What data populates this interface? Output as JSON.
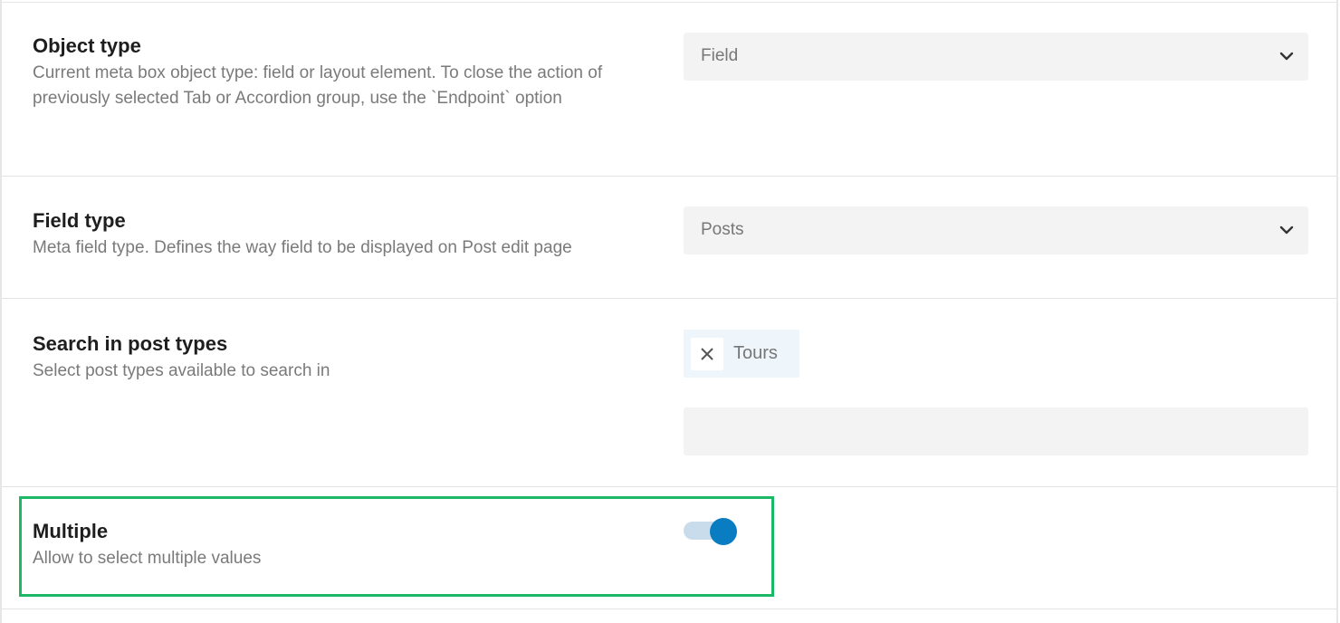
{
  "fields": {
    "object_type": {
      "title": "Object type",
      "description": "Current meta box object type: field or layout element. To close the action of previously selected Tab or Accordion group, use the `Endpoint` option",
      "value": "Field"
    },
    "field_type": {
      "title": "Field type",
      "description": "Meta field type. Defines the way field to be displayed on Post edit page",
      "value": "Posts"
    },
    "search_post_types": {
      "title": "Search in post types",
      "description": "Select post types available to search in",
      "selected_tags": [
        {
          "label": "Tours"
        }
      ],
      "search_value": ""
    },
    "multiple": {
      "title": "Multiple",
      "description": "Allow to select multiple values",
      "enabled": true
    }
  },
  "icons": {
    "select_chevron": "chevron-down-icon",
    "tag_remove": "close-icon"
  },
  "colors": {
    "highlight_border": "#1db866",
    "toggle_on": "#0a7cc1",
    "toggle_track": "#c8dcec"
  }
}
